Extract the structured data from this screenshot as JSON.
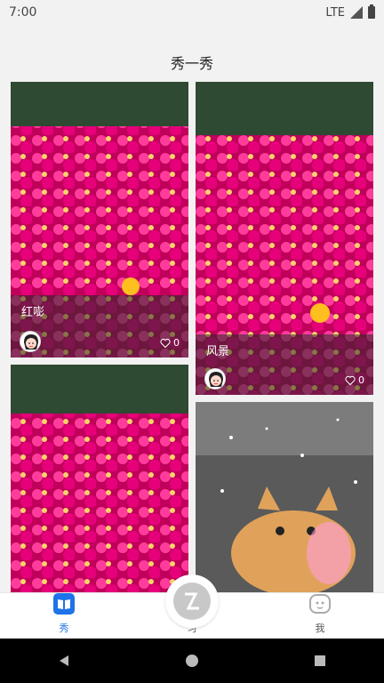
{
  "status": {
    "time": "7:00",
    "network": "LTE"
  },
  "header": {
    "title": "秀一秀"
  },
  "cards": [
    {
      "caption": "红嘭",
      "likes": "0"
    },
    {
      "caption": "风景",
      "likes": "0"
    }
  ],
  "bottom_nav": {
    "items": [
      {
        "label": "秀",
        "icon": "book-icon",
        "active": true
      },
      {
        "label": "习",
        "icon": "study-icon",
        "active": false
      },
      {
        "label": "我",
        "icon": "profile-face-icon",
        "active": false
      }
    ]
  },
  "colors": {
    "accent": "#1e73e8"
  }
}
